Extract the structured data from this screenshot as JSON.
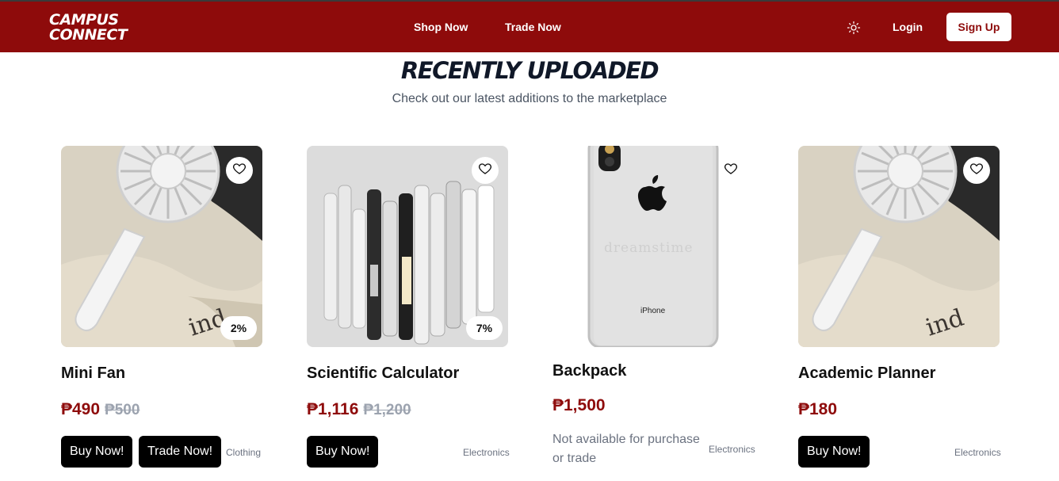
{
  "nav": {
    "logo_line1": "CAMPUS",
    "logo_line2": "CONNECT",
    "links": [
      "Shop Now",
      "Trade Now"
    ],
    "theme_icon": "sun-icon",
    "login": "Login",
    "signup": "Sign Up"
  },
  "section": {
    "title": "RECENTLY UPLOADED",
    "subtitle": "Check out our latest additions to the marketplace"
  },
  "products": [
    {
      "name": "Mini Fan",
      "price": "₱490",
      "old_price": "₱500",
      "discount": "2%",
      "category": "Clothing",
      "buttons": [
        "Buy Now!",
        "Trade Now!"
      ],
      "image": "mini-fan-image"
    },
    {
      "name": "Scientific Calculator",
      "price": "₱1,116",
      "old_price": "₱1,200",
      "discount": "7%",
      "category": "Electronics",
      "buttons": [
        "Buy Now!"
      ],
      "image": "pens-image"
    },
    {
      "name": "Backpack",
      "price": "₱1,500",
      "note": "Not available for purchase or trade",
      "category": "Electronics",
      "image": "iphone-image",
      "image_text": "iPhone",
      "watermark": "dreamstime"
    },
    {
      "name": "Academic Planner",
      "price": "₱180",
      "category": "Electronics",
      "buttons": [
        "Buy Now!"
      ],
      "image": "mini-fan-image"
    }
  ],
  "colors": {
    "brand": "#8e0b0b",
    "button": "#000000",
    "muted": "#6b7280"
  }
}
